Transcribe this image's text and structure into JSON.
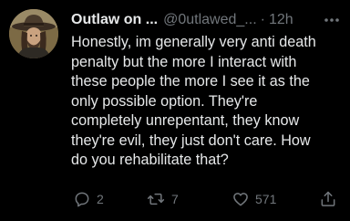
{
  "tweet": {
    "display_name": "Outlaw on ...",
    "handle": "@0utlawed_...",
    "separator": "·",
    "time": "12h",
    "text_lines": [
      "Honestly, im generally very anti death",
      "penalty but the more I interact with",
      "these people the more I see it as the",
      "only possible option. They're",
      "completely unrepentant, they know",
      "they're evil, they just don't care. How",
      "do you rehabilitate that?"
    ],
    "counts": {
      "replies": "2",
      "retweets": "7",
      "likes": "571"
    }
  },
  "icons": {
    "reply": "reply-icon",
    "retweet": "retweet-icon",
    "like": "heart-icon",
    "share": "share-icon",
    "more": "more-icon"
  },
  "colors": {
    "background": "#000000",
    "primary_text": "#e7e9ea",
    "secondary_text": "#71767b"
  }
}
